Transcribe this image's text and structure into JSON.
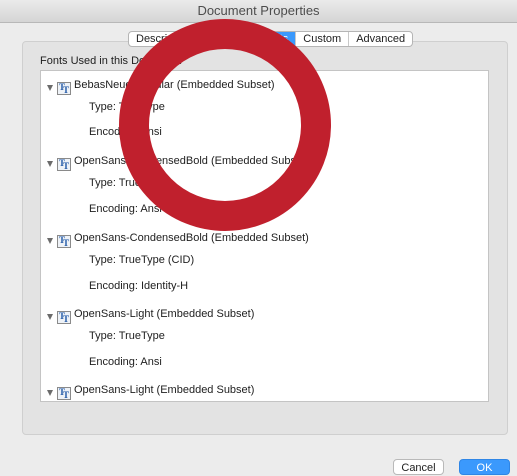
{
  "window": {
    "title": "Document Properties"
  },
  "tabs": [
    {
      "label": "Description",
      "active": false
    },
    {
      "label": "Security",
      "active": false
    },
    {
      "label": "Fonts",
      "active": true
    },
    {
      "label": "Custom",
      "active": false
    },
    {
      "label": "Advanced",
      "active": false
    }
  ],
  "fonts_section": {
    "label": "Fonts Used in this Document"
  },
  "fonts": [
    {
      "name": "BebasNeue-Regular (Embedded Subset)",
      "type": "Type: TrueType",
      "encoding": "Encoding: Ansi"
    },
    {
      "name": "OpenSans-CondensedBold (Embedded Subset)",
      "type": "Type: TrueType",
      "encoding": "Encoding: Ansi"
    },
    {
      "name": "OpenSans-CondensedBold (Embedded Subset)",
      "type": "Type: TrueType (CID)",
      "encoding": "Encoding: Identity-H"
    },
    {
      "name": "OpenSans-Light (Embedded Subset)",
      "type": "Type: TrueType",
      "encoding": "Encoding: Ansi"
    },
    {
      "name": "OpenSans-Light (Embedded Subset)"
    }
  ],
  "buttons": {
    "cancel": "Cancel",
    "ok": "OK"
  },
  "icons": {
    "expand": "disclosure-triangle-icon",
    "font": "truetype-font-icon"
  },
  "colors": {
    "accent": "#3b99fc",
    "annotation": "#c0202d"
  }
}
